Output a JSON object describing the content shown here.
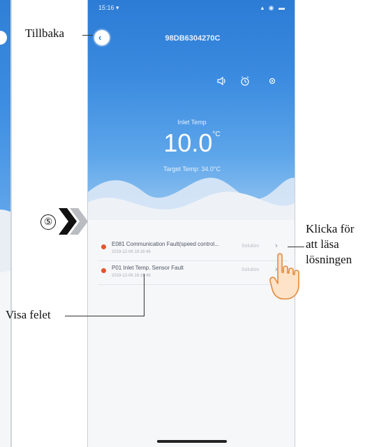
{
  "app": {
    "status_time": "15:16 ▾",
    "status_icons": "▴ ◉ ▬",
    "device_id": "98DB6304270C",
    "inlet_label": "Inlet Temp",
    "inlet_value": "10.0",
    "inlet_unit": "°C",
    "target_label": "Target Temp: 34.0°C"
  },
  "toolbar": {
    "sound_icon": "speaker-icon",
    "timer_icon": "alarm-clock-icon",
    "settings_icon": "gear-icon"
  },
  "faults": [
    {
      "title": "E081 Communication Fault(speed control...",
      "time": "2019-12-06 16:16:46",
      "solution": "Solution",
      "chevron": "›"
    },
    {
      "title": "P01 Inlet Temp. Sensor Fault",
      "time": "2019-12-06 16:16:46",
      "solution": "Solution",
      "chevron": "›"
    }
  ],
  "annotations": {
    "back": "Tillbaka",
    "click_line1": "Klicka för",
    "click_line2": "att läsa",
    "click_line3": "lösningen",
    "view_fault": "Visa felet",
    "step": "⑤"
  },
  "colors": {
    "hero_top": "#2c7bd5",
    "fault_dot": "#e5542c",
    "arrow_dark": "#111111",
    "arrow_light": "#b9bcc0"
  }
}
